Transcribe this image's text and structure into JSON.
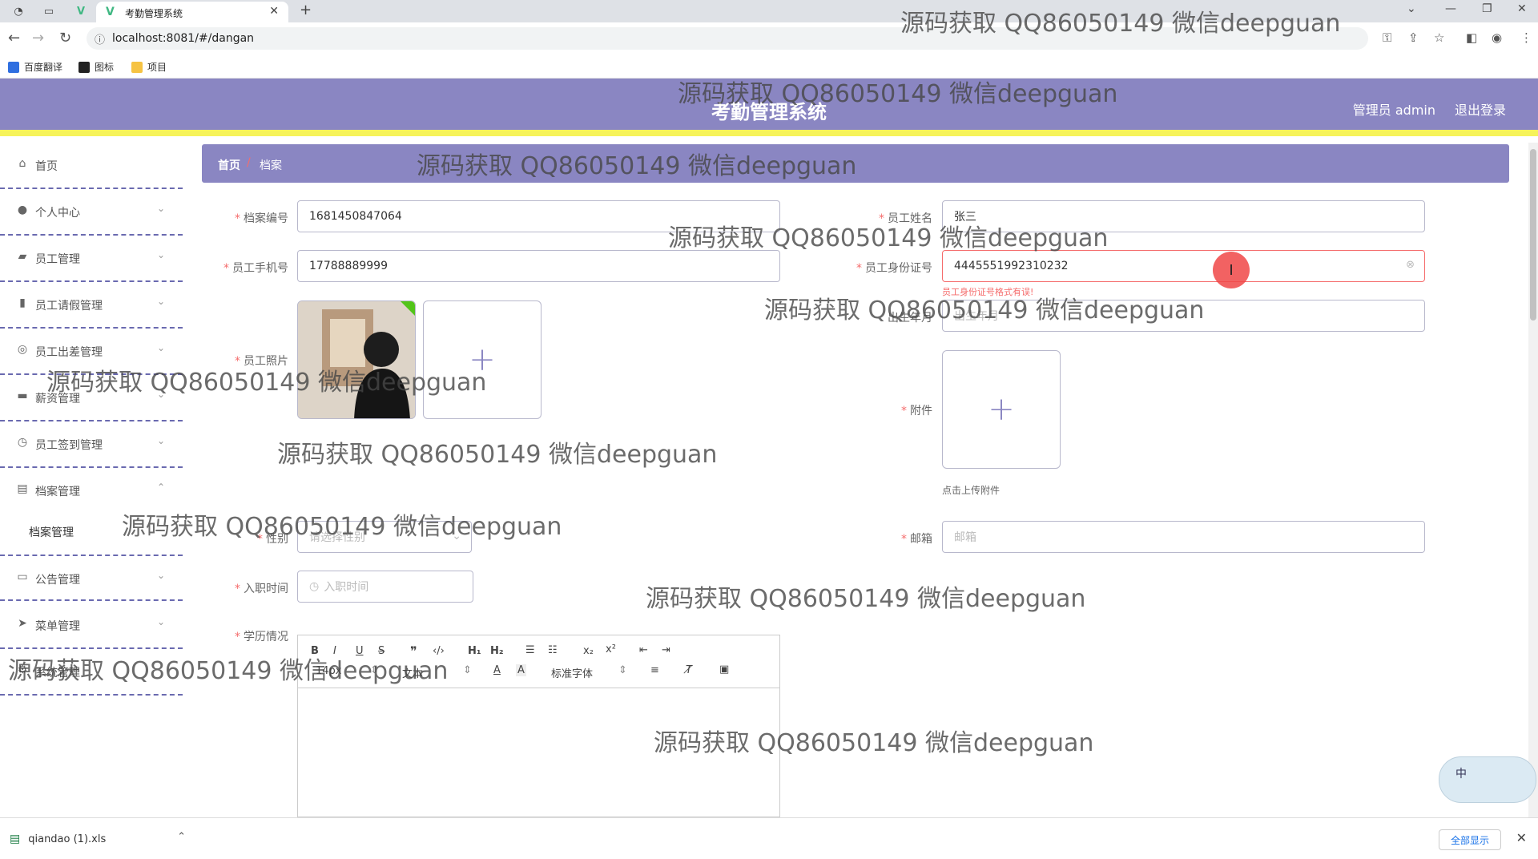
{
  "browser": {
    "tab_title": "考勤管理系统",
    "url": "localhost:8081/#/dangan",
    "bookmarks": [
      "百度翻译",
      "图标",
      "项目"
    ]
  },
  "header": {
    "title": "考勤管理系统",
    "admin": "管理员 admin",
    "logout": "退出登录"
  },
  "sidebar": {
    "items": [
      {
        "label": "首页"
      },
      {
        "label": "个人中心"
      },
      {
        "label": "员工管理"
      },
      {
        "label": "员工请假管理"
      },
      {
        "label": "员工出差管理"
      },
      {
        "label": "薪资管理"
      },
      {
        "label": "员工签到管理"
      },
      {
        "label": "档案管理"
      },
      {
        "label": "公告管理"
      },
      {
        "label": "菜单管理"
      },
      {
        "label": "系统管理"
      }
    ],
    "sub_item": "档案管理"
  },
  "breadcrumb": {
    "home": "首页",
    "separator": "/",
    "current": "档案"
  },
  "form": {
    "archive_no": {
      "label": "档案编号",
      "value": "1681450847064"
    },
    "name": {
      "label": "员工姓名",
      "value": "张三"
    },
    "phone": {
      "label": "员工手机号",
      "value": "17788889999"
    },
    "id_card": {
      "label": "员工身份证号",
      "value": "4445551992310232",
      "error": "员工身份证号格式有误!"
    },
    "birth": {
      "label": "出生年月",
      "placeholder": "出生年月"
    },
    "photo": {
      "label": "员工照片"
    },
    "attachment": {
      "label": "附件",
      "hint": "点击上传附件"
    },
    "gender": {
      "label": "性别",
      "placeholder": "请选择性别"
    },
    "email": {
      "label": "邮箱",
      "placeholder": "邮箱"
    },
    "hire_date": {
      "label": "入职时间",
      "placeholder": "入职时间"
    },
    "education": {
      "label": "学历情况"
    }
  },
  "editor": {
    "size": "14px",
    "text_style": "文本",
    "font": "标准字体"
  },
  "download": {
    "file": "qiandao (1).xls",
    "show_all": "全部显示"
  },
  "ime": {
    "label": "中"
  },
  "watermark": "源码获取 QQ86050149 微信deepguan"
}
